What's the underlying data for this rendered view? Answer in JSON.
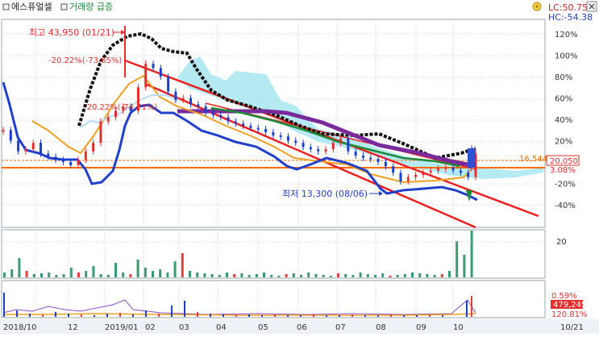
{
  "header": {
    "stock_name": "에스퓨얼셀",
    "legend_label": "거래량 급증",
    "lc_label": "LC:50.75",
    "hc_label": "HC:-54.38",
    "settings_icon": "gear-icon",
    "close_icon": "close-icon"
  },
  "annotations": {
    "high": "최고 43,950 (01/21)",
    "low": "최저 13,300 (08/06)",
    "drop1": "-20.22%(-73.65%)",
    "drop2": "-20.22%(-74.71%)"
  },
  "price_tags": {
    "level_line": "16,544",
    "current_price": "20,050",
    "current_pct": "3.08%"
  },
  "volume_panel": {
    "tick_label": "20"
  },
  "indicator_panel": {
    "tick_label": "0.59%",
    "value1": "479,245",
    "value2": "120.81%"
  },
  "colors": {
    "up": "#e62e2e",
    "down": "#1a3fcf",
    "trend": "#ee2020",
    "ma": "#f0a020",
    "purple_ma": "#7a2a9a",
    "black_line": "#111111",
    "cloud": "#a8e6f0",
    "volume": "#3a9a70",
    "level": "#ff6a00"
  },
  "chart_data": {
    "type": "line",
    "title": "",
    "y_axis_label": "",
    "y_ticks": [
      "120%",
      "100%",
      "80%",
      "60%",
      "40%",
      "20%",
      "-20%",
      "-40%"
    ],
    "y_values": [
      120,
      100,
      80,
      60,
      40,
      20,
      -20,
      -40
    ],
    "ylim": [
      -60,
      130
    ],
    "x_ticks": [
      "2018/10",
      "12",
      "2019/01",
      "02",
      "03",
      "04",
      "05",
      "06",
      "07",
      "08",
      "09",
      "10",
      "10/21"
    ],
    "price_pct_series": [
      [
        0,
        30
      ],
      [
        2,
        20
      ],
      [
        4,
        10
      ],
      [
        6,
        12
      ],
      [
        8,
        18
      ],
      [
        10,
        8
      ],
      [
        12,
        5
      ],
      [
        14,
        2
      ],
      [
        16,
        0
      ],
      [
        18,
        -3
      ],
      [
        20,
        2
      ],
      [
        22,
        10
      ],
      [
        24,
        18
      ],
      [
        26,
        38
      ],
      [
        28,
        42
      ],
      [
        30,
        48
      ],
      [
        32,
        52
      ],
      [
        34,
        48
      ],
      [
        36,
        70
      ],
      [
        38,
        92
      ],
      [
        40,
        88
      ],
      [
        42,
        80
      ],
      [
        44,
        66
      ],
      [
        46,
        58
      ],
      [
        48,
        60
      ],
      [
        50,
        54
      ],
      [
        52,
        52
      ],
      [
        54,
        46
      ],
      [
        56,
        44
      ],
      [
        58,
        42
      ],
      [
        60,
        38
      ],
      [
        62,
        36
      ],
      [
        64,
        34
      ],
      [
        66,
        32
      ],
      [
        68,
        31
      ],
      [
        70,
        28
      ],
      [
        72,
        25
      ],
      [
        74,
        24
      ],
      [
        76,
        20
      ],
      [
        78,
        18
      ],
      [
        80,
        14
      ],
      [
        82,
        12
      ],
      [
        84,
        10
      ],
      [
        86,
        12
      ],
      [
        88,
        18
      ],
      [
        90,
        22
      ],
      [
        92,
        10
      ],
      [
        94,
        6
      ],
      [
        96,
        4
      ],
      [
        98,
        3
      ],
      [
        100,
        0
      ],
      [
        102,
        -4
      ],
      [
        104,
        -10
      ],
      [
        106,
        -18
      ],
      [
        108,
        -14
      ],
      [
        110,
        -12
      ],
      [
        112,
        -10
      ],
      [
        114,
        -8
      ],
      [
        116,
        -6
      ],
      [
        118,
        -5
      ],
      [
        120,
        -8
      ],
      [
        122,
        -10
      ],
      [
        124,
        -14
      ],
      [
        126,
        8
      ]
    ],
    "scale_note": "Percent change from reference close"
  }
}
